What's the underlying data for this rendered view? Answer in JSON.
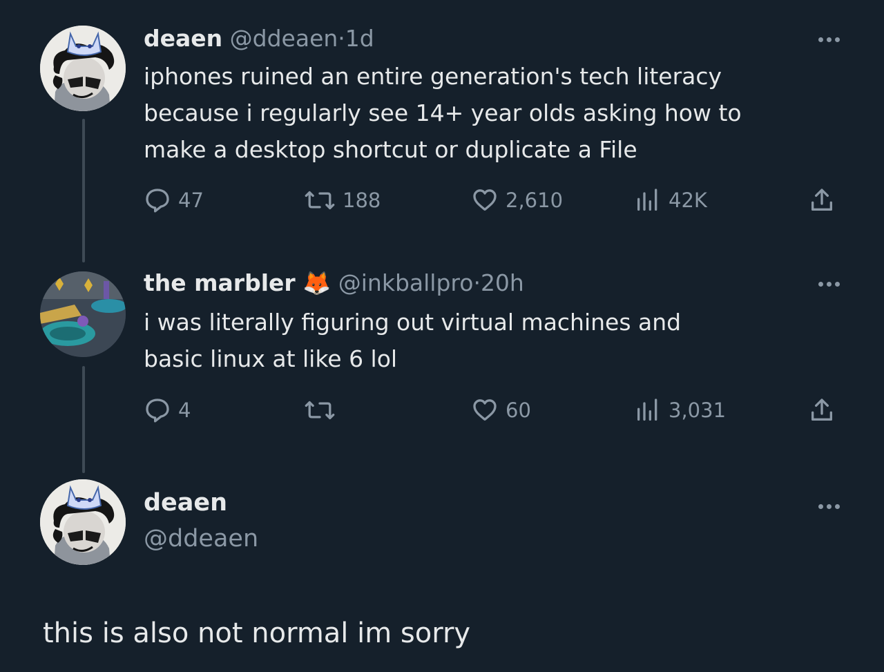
{
  "tweet1": {
    "name": "deaen",
    "handle": "@ddeaen",
    "separator": "·",
    "time": "1d",
    "lines": [
      "iphones ruined an entire generation's tech literacy",
      "because i regularly see 14+ year olds asking how to",
      "make a desktop shortcut or duplicate a File"
    ],
    "replies": "47",
    "reposts": "188",
    "likes": "2,610",
    "views": "42K"
  },
  "tweet2": {
    "name": "the marbler",
    "emoji": "🦊",
    "handle": "@inkballpro",
    "separator": "·",
    "time": "20h",
    "lines": [
      "i was literally figuring out virtual machines and",
      "basic linux at like 6 lol"
    ],
    "replies": "4",
    "reposts": "",
    "likes": "60",
    "views": "3,031"
  },
  "reply_box": {
    "name": "deaen",
    "handle": "@ddeaen",
    "text": "this is also not normal im sorry"
  },
  "icons": [
    "reply-icon",
    "repost-icon",
    "like-icon",
    "views-icon",
    "share-icon",
    "more-icon"
  ],
  "colors": {
    "background": "#15202b",
    "text": "#e7e9ea",
    "muted": "#8b98a5",
    "thread_line": "#3e4a55"
  }
}
